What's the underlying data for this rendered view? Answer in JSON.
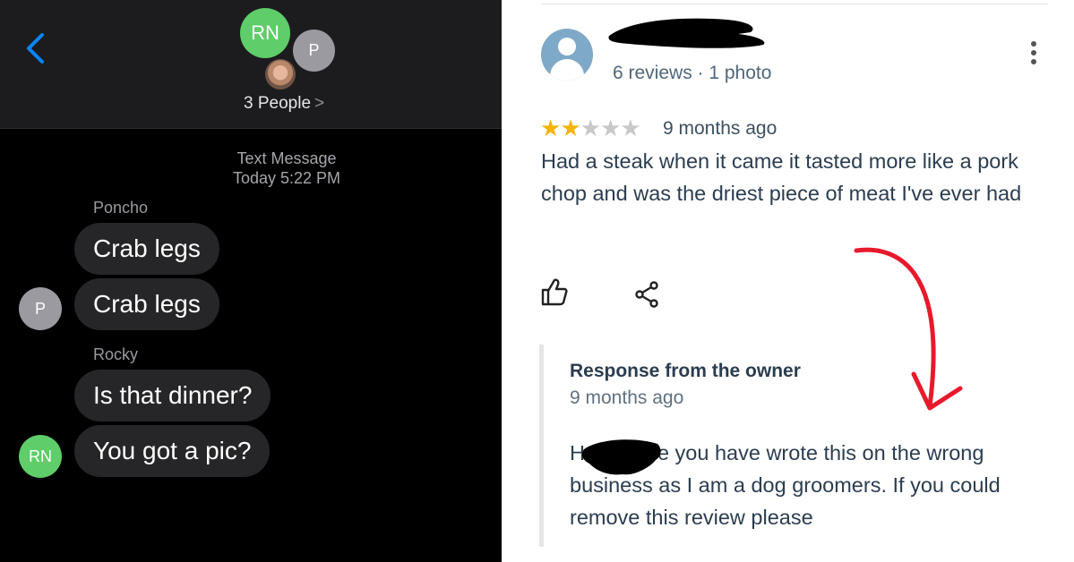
{
  "messages_app": {
    "header": {
      "avatar_rn": "RN",
      "avatar_p": "P",
      "people_label": "3 People",
      "people_chevron": ">"
    },
    "timestamp": {
      "line1": "Text Message",
      "line2": "Today 5:22 PM"
    },
    "groups": [
      {
        "sender": "Poncho",
        "avatar": "P",
        "messages": [
          "Crab legs",
          "Crab legs"
        ]
      },
      {
        "sender": "Rocky",
        "avatar": "RN",
        "messages": [
          "Is that dinner?",
          "You got a pic?"
        ]
      }
    ],
    "colors": {
      "background": "#000000",
      "bubble": "#262628",
      "rn_avatar": "#5ecd6a",
      "p_avatar": "#9a9aa0",
      "back_chevron": "#0a84ff"
    }
  },
  "review_app": {
    "reviewer_meta": "6 reviews · 1 photo",
    "rating": 2,
    "rating_max": 5,
    "time_ago": "9 months ago",
    "review_text": "Had a steak when it came it tasted more like a pork chop and was the driest piece of meat I've ever had",
    "response": {
      "title": "Response from the owner",
      "time_ago": "9 months ago",
      "text": "H          I believe you have wrote this on the wrong business as I am a dog groomers. If you could remove this review please"
    },
    "colors": {
      "star_on": "#f4b400",
      "star_off": "#c8c8c8",
      "arrow": "#e8192c"
    }
  }
}
